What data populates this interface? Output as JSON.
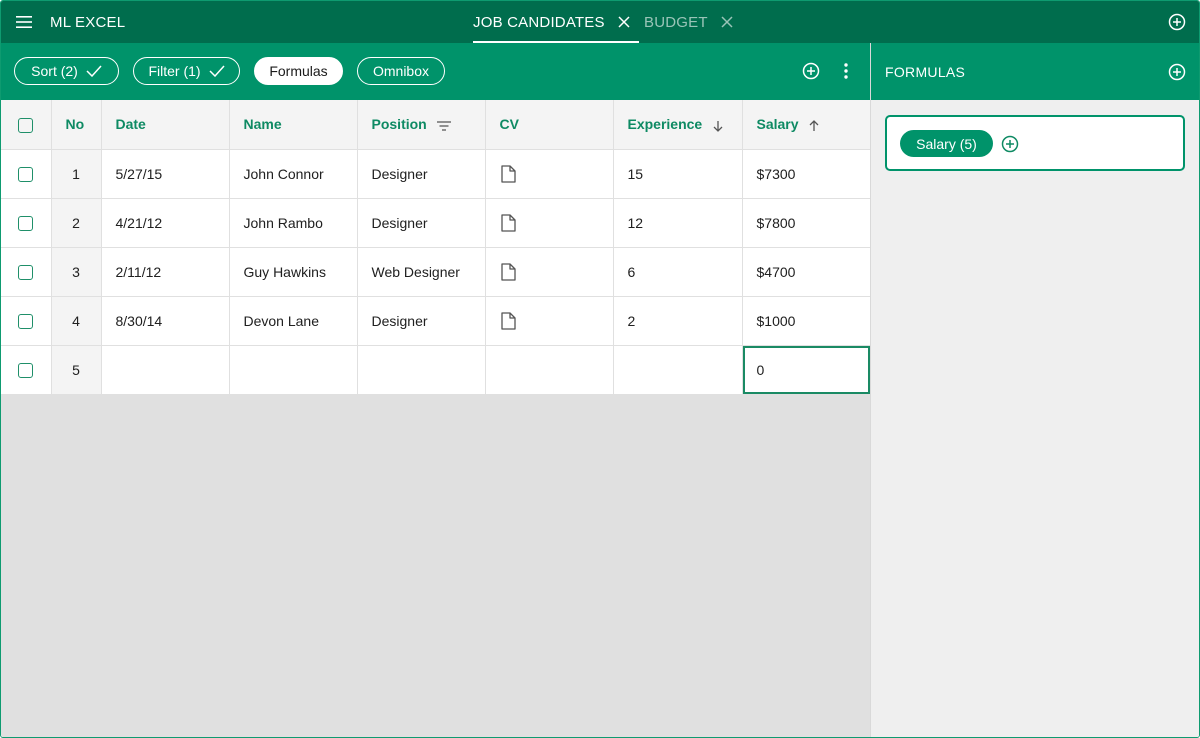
{
  "app": {
    "title": "ML EXCEL"
  },
  "tabs": [
    {
      "label": "JOB CANDIDATES",
      "active": true
    },
    {
      "label": "BUDGET",
      "active": false
    }
  ],
  "toolbar": {
    "chips": [
      {
        "label": "Sort (2)",
        "checked": true
      },
      {
        "label": "Filter (1)",
        "checked": true
      },
      {
        "label": "Formulas",
        "selected": true
      },
      {
        "label": "Omnibox"
      }
    ]
  },
  "panel": {
    "title": "FORMULAS",
    "formula_chip": "Salary (5)"
  },
  "table": {
    "headers": {
      "no": "No",
      "date": "Date",
      "name": "Name",
      "position": "Position",
      "cv": "CV",
      "experience": "Experience",
      "salary": "Salary"
    },
    "rows": [
      {
        "no": "1",
        "date": "5/27/15",
        "name": "John Connor",
        "position": "Designer",
        "experience": "15",
        "salary": "$7300"
      },
      {
        "no": "2",
        "date": "4/21/12",
        "name": "John Rambo",
        "position": "Designer",
        "experience": "12",
        "salary": "$7800"
      },
      {
        "no": "3",
        "date": "2/11/12",
        "name": "Guy Hawkins",
        "position": "Web Designer",
        "experience": "6",
        "salary": "$4700"
      },
      {
        "no": "4",
        "date": "8/30/14",
        "name": "Devon Lane",
        "position": "Designer",
        "experience": "2",
        "salary": "$1000"
      },
      {
        "no": "5",
        "date": "",
        "name": "",
        "position": "",
        "experience": "",
        "salary": "0"
      }
    ]
  },
  "colors": {
    "top_bar": "#006d4d",
    "toolbar": "#00936a",
    "accent_text": "#0e8a63",
    "panel_background": "#efefef",
    "table_empty_area": "#e0e0e0"
  },
  "icons": {
    "menu": "hamburger-icon",
    "close": "close-icon",
    "add": "add-circle-icon",
    "check": "check-icon",
    "more": "more-vertical-icon",
    "filter": "filter-lines-icon",
    "sort_down": "arrow-down-icon",
    "sort_up": "arrow-up-icon",
    "document": "document-icon"
  }
}
